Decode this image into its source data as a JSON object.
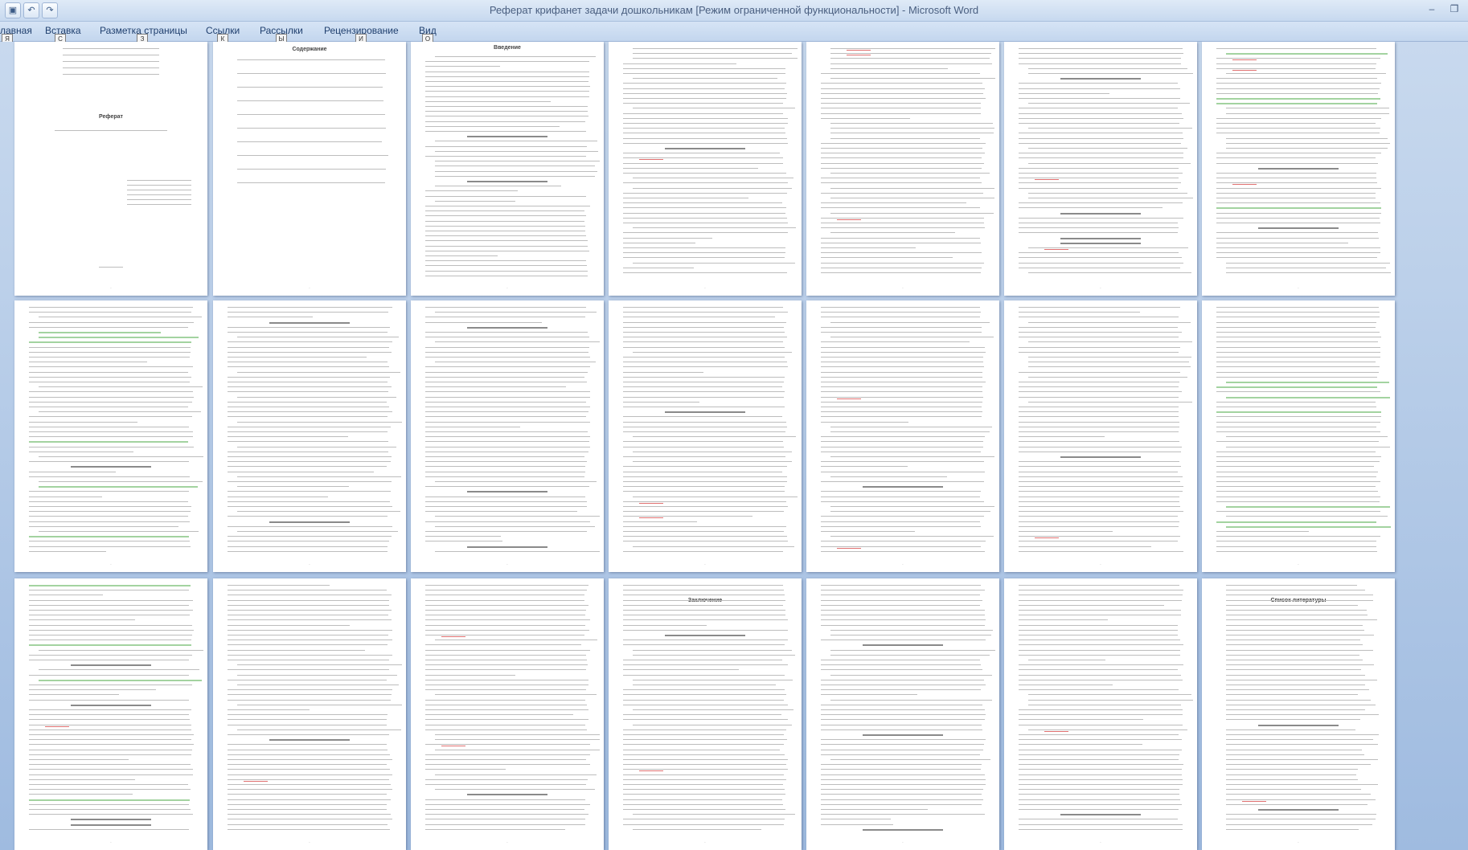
{
  "window": {
    "title": "Реферат крифанет задачи дошкольникам [Режим ограниченной функциональности] - Microsoft Word",
    "quick_access": [
      "save-icon",
      "undo-icon",
      "redo-icon"
    ]
  },
  "ribbon": {
    "tabs": [
      {
        "label": "лавная",
        "key": "Я"
      },
      {
        "label": "Вставка",
        "key": "С"
      },
      {
        "label": "Разметка страницы",
        "key": "З"
      },
      {
        "label": "Ссылки",
        "key": "К"
      },
      {
        "label": "Рассылки",
        "key": "Ы"
      },
      {
        "label": "Рецензирование",
        "key": "И"
      },
      {
        "label": "Вид",
        "key": "О"
      }
    ]
  },
  "document": {
    "title_page": {
      "heading": "Реферат"
    },
    "contents_page": {
      "heading": "Содержание"
    },
    "intro_page": {
      "heading": "Введение"
    },
    "conclusion_heading": "Заключение",
    "bibliography_heading": "Список литературы"
  }
}
